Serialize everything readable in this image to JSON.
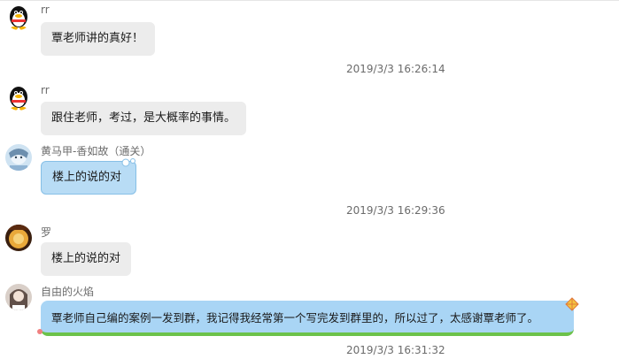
{
  "messages": [
    {
      "sender": "rr",
      "text": "覃老师讲的真好！"
    },
    {
      "sender": "rr",
      "text": "跟住老师，考过，是大概率的事情。"
    },
    {
      "sender": "黄马甲-香如故（通关）",
      "text": "楼上的说的对"
    },
    {
      "sender": "罗",
      "text": "楼上的说的对"
    },
    {
      "sender": "自由的火焰",
      "text": "覃老师自己编的案例一发到群，我记得我经常第一个写完发到群里的，所以过了，太感谢覃老师了。"
    }
  ],
  "timestamps": [
    "2019/3/3 16:26:14",
    "2019/3/3 16:29:36",
    "2019/3/3 16:31:32"
  ],
  "colors": {
    "bubble_gray": "#ececec",
    "bubble_blue": "#b8dcf5",
    "accent_green": "#6cc24a"
  }
}
